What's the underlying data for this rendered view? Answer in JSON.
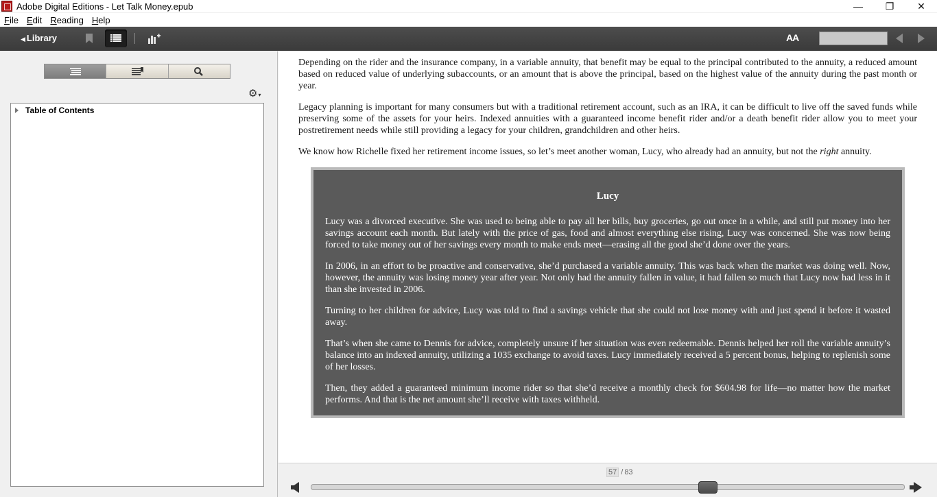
{
  "window": {
    "title": "Adobe Digital Editions - Let Talk Money.epub",
    "minimize": "—",
    "maximize": "❐",
    "close": "✕"
  },
  "menu": {
    "items": [
      {
        "accel": "F",
        "rest": "ile"
      },
      {
        "accel": "E",
        "rest": "dit"
      },
      {
        "accel": "R",
        "rest": "eading"
      },
      {
        "accel": "H",
        "rest": "elp"
      }
    ]
  },
  "toolbar": {
    "library_label": "Library",
    "font_label": "AA",
    "search_value": "",
    "icons": [
      "bookmark-icon",
      "toc-list-icon",
      "stats-add-icon",
      "font-size-icon",
      "prev-page-icon",
      "next-page-icon"
    ]
  },
  "sidebar": {
    "tabs": [
      "toc-view-icon",
      "bookmarks-view-icon",
      "search-view-icon"
    ],
    "active_tab": 0,
    "toc_root": "Table of Contents"
  },
  "content": {
    "p1": "Depending on the rider and the insurance company, in a variable annuity, that benefit may be equal to the principal contributed to the annuity, a reduced amount based on reduced value of underlying subaccounts, or an amount that is above the principal, based on the highest value of the annuity during the past month or year.",
    "p2": "Legacy planning is important for many consumers but with a traditional retirement account, such as an IRA, it can be difficult to live off the saved funds while preserving some of the assets for your heirs. Indexed annuities with a guaranteed income benefit rider and/or a death benefit rider allow you to meet your postretirement needs while still providing a legacy for your children, grandchildren and other heirs.",
    "p3_before": "We know how Richelle fixed her retirement income issues, so let’s meet another woman, Lucy, who already had an annuity, but not the ",
    "p3_em": "right",
    "p3_after": " annuity.",
    "box": {
      "title": "Lucy",
      "paragraphs": [
        "Lucy was a divorced executive. She was used to being able to pay all her bills, buy groceries, go out once in a while, and still put money into her savings account each month. But lately with the price of gas, food and almost everything else rising, Lucy was concerned. She was now being forced to take money out of her savings every month to make ends meet—erasing all the good she’d done over the years.",
        "In 2006, in an effort to be proactive and conservative, she’d purchased a variable annuity. This was back when the market was doing well. Now, however, the annuity was losing money year after year. Not only had the annuity fallen in value, it had fallen so much that Lucy now had less in it than she invested in 2006.",
        "Turning to her children for advice, Lucy was told to find a savings vehicle that she could not lose money with and just spend it before it wasted away.",
        "That’s when she came to Dennis for advice, completely unsure if her situation was even redeemable. Dennis helped her roll the variable annuity’s balance into an indexed annuity, utilizing a 1035 exchange to avoid taxes. Lucy immediately received a 5 percent bonus, helping to replenish some of her losses.",
        "Then, they added a guaranteed minimum income rider so that she’d receive a monthly check for $604.98 for life—no matter how the market performs. And that is the net amount she’ll receive with taxes withheld."
      ]
    }
  },
  "pager": {
    "current": "57",
    "separator": "/",
    "total": "83",
    "progress_fraction": 0.675
  },
  "colors": {
    "toolbar_bg": "#444444",
    "box_bg": "#5a5a5a",
    "box_border": "#b9b9b9"
  }
}
